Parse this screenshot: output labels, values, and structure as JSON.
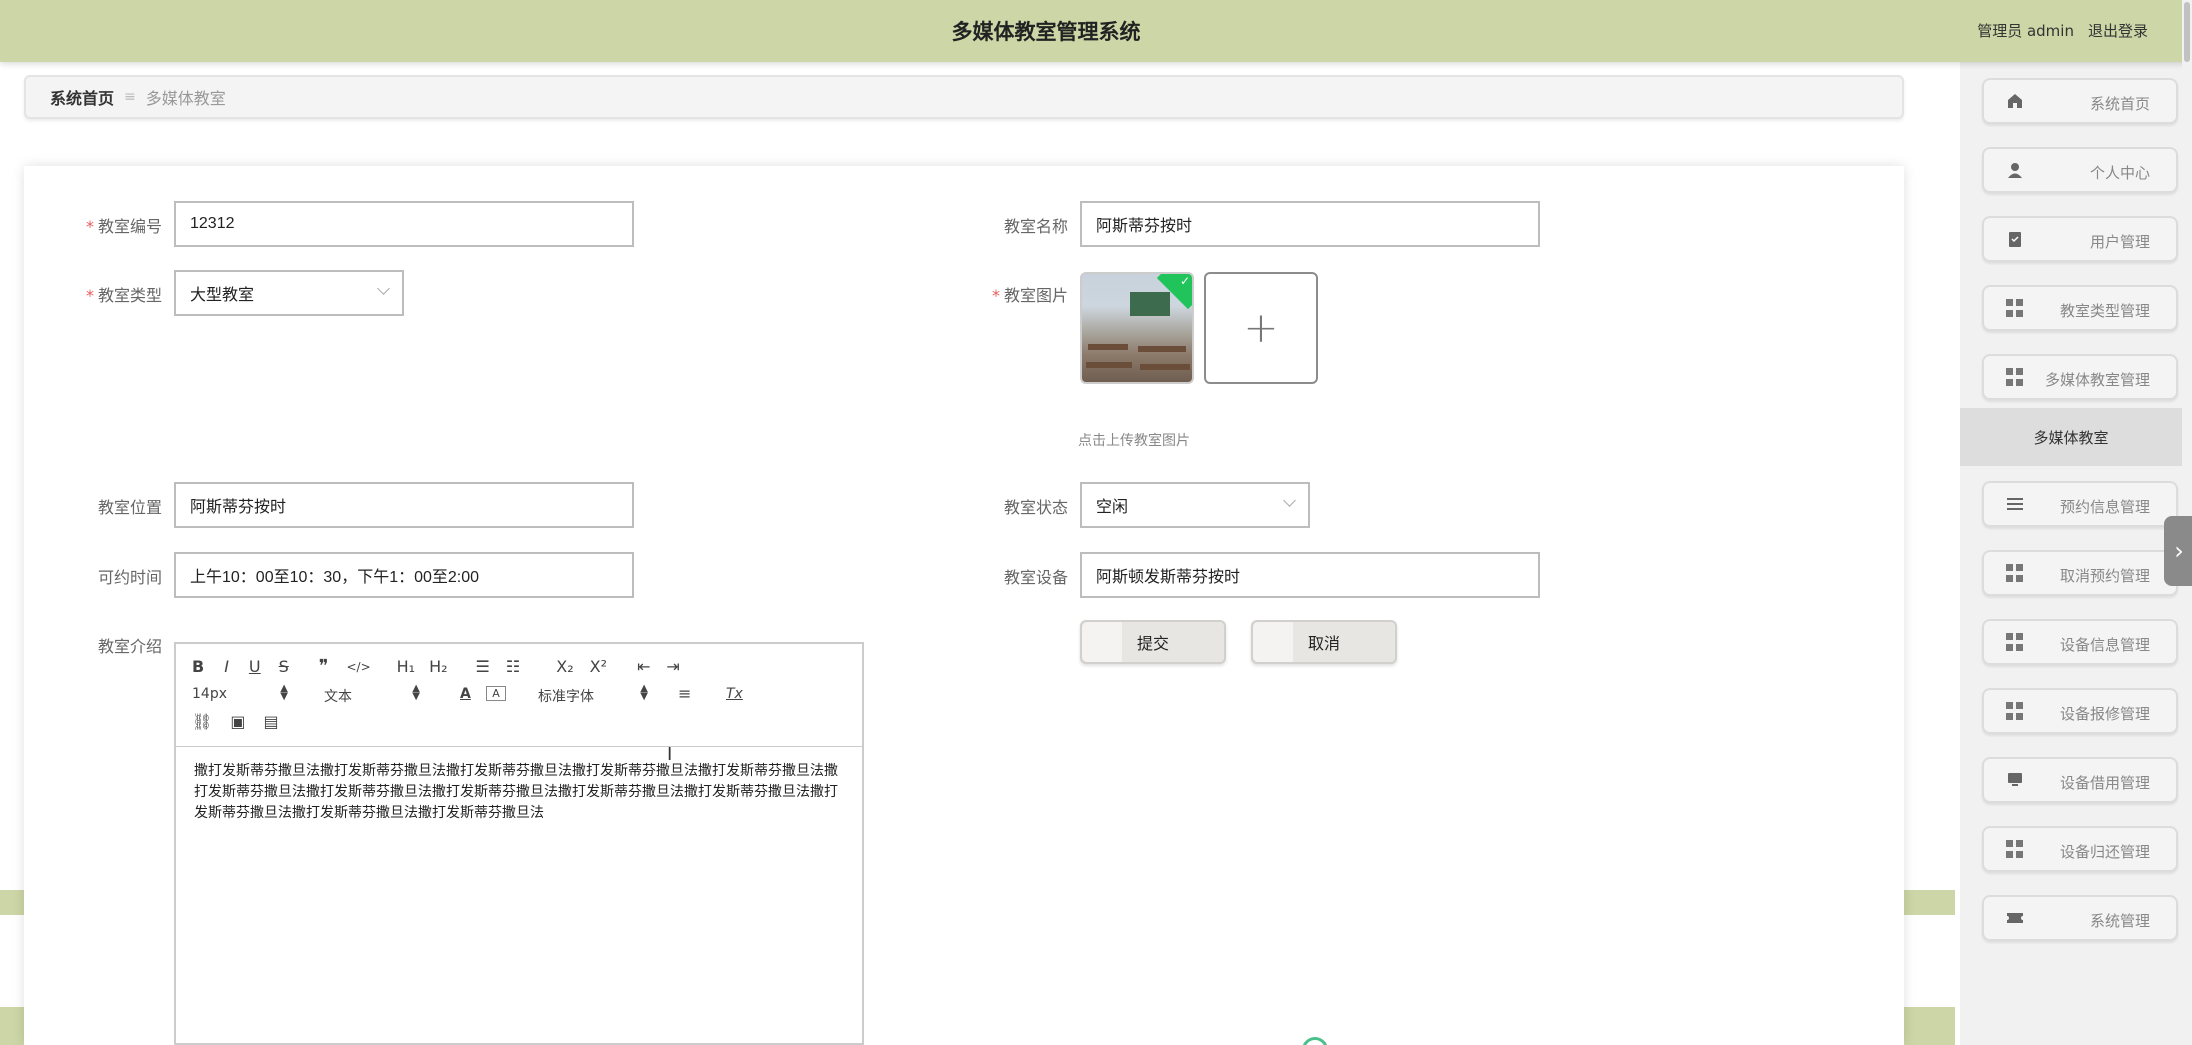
{
  "header": {
    "title": "多媒体教室管理系统",
    "user_label": "管理员 admin",
    "logout_label": "退出登录"
  },
  "breadcrumb": {
    "home": "系统首页",
    "separator": "≡",
    "current": "多媒体教室"
  },
  "form": {
    "room_number": {
      "label": "教室编号",
      "value": "12312",
      "required": true
    },
    "room_name": {
      "label": "教室名称",
      "value": "阿斯蒂芬按时",
      "required": false
    },
    "room_type": {
      "label": "教室类型",
      "value": "大型教室",
      "required": true
    },
    "room_image": {
      "label": "教室图片",
      "required": true,
      "hint": "点击上传教室图片"
    },
    "room_location": {
      "label": "教室位置",
      "value": "阿斯蒂芬按时"
    },
    "room_status": {
      "label": "教室状态",
      "value": "空闲"
    },
    "available_time": {
      "label": "可约时间",
      "value": "上午10：00至10：30，下午1：00至2:00"
    },
    "room_equipment": {
      "label": "教室设备",
      "value": "阿斯顿发斯蒂芬按时"
    },
    "room_intro": {
      "label": "教室介绍",
      "content": "撒打发斯蒂芬撒旦法撒打发斯蒂芬撒旦法撒打发斯蒂芬撒旦法撒打发斯蒂芬撒旦法撒打发斯蒂芬撒旦法撒打发斯蒂芬撒旦法撒打发斯蒂芬撒旦法撒打发斯蒂芬撒旦法撒打发斯蒂芬撒旦法撒打发斯蒂芬撒旦法撒打发斯蒂芬撒旦法撒打发斯蒂芬撒旦法撒打发斯蒂芬撒旦法"
    },
    "submit_label": "提交",
    "cancel_label": "取消"
  },
  "editor_toolbar": {
    "font_size": "14px",
    "header_select": "文本",
    "font_family": "标准字体",
    "buttons": [
      "B",
      "I",
      "U",
      "S",
      "❞",
      "</>",
      "H1",
      "H2",
      "ordered-list",
      "bullet-list",
      "X₂",
      "X²",
      "outdent",
      "indent",
      "text-color",
      "background-color",
      "align",
      "clean-format",
      "link",
      "image",
      "video"
    ]
  },
  "sidebar": {
    "items": [
      {
        "label": "系统首页",
        "icon": "home-icon"
      },
      {
        "label": "个人中心",
        "icon": "user-icon"
      },
      {
        "label": "用户管理",
        "icon": "clipboard-icon"
      },
      {
        "label": "教室类型管理",
        "icon": "grid-icon"
      },
      {
        "label": "多媒体教室管理",
        "icon": "grid-icon"
      },
      {
        "label": "预约信息管理",
        "icon": "menu-icon"
      },
      {
        "label": "取消预约管理",
        "icon": "grid-icon"
      },
      {
        "label": "设备信息管理",
        "icon": "grid-icon"
      },
      {
        "label": "设备报修管理",
        "icon": "grid-icon"
      },
      {
        "label": "设备借用管理",
        "icon": "monitor-icon"
      },
      {
        "label": "设备归还管理",
        "icon": "grid-icon"
      },
      {
        "label": "系统管理",
        "icon": "ticket-icon"
      }
    ],
    "active_sub": "多媒体教室"
  },
  "colors": {
    "header_bg": "#ccd6a6",
    "required_star": "#e85c5c",
    "sidebar_bg": "#f1f1f1",
    "upload_badge": "#21c45a"
  }
}
